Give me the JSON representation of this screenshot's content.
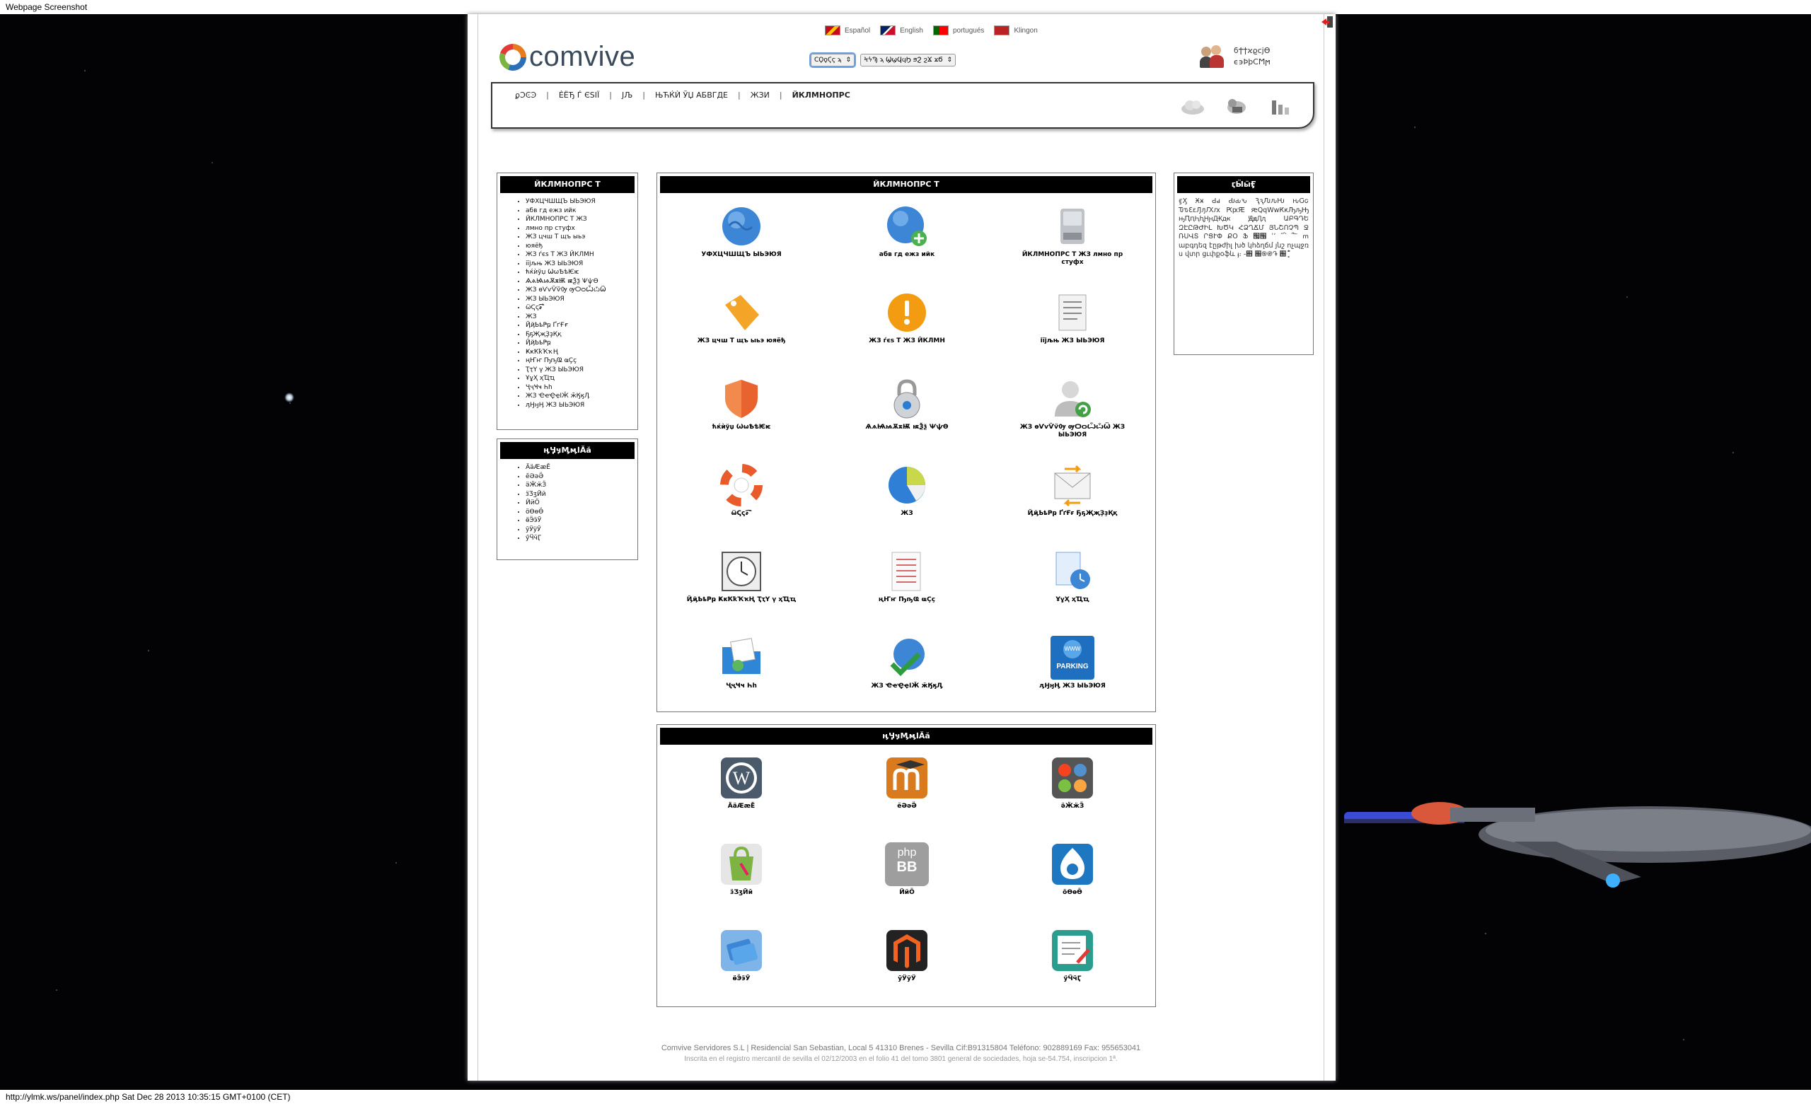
{
  "capture": {
    "top_label": "Webpage Screenshot",
    "bottom_label": "http://ylmk.ws/panel/index.php Sat Dec 28 2013 10:35:15 GMT+0100 (CET)"
  },
  "header": {
    "logo_text": "comvive",
    "languages": [
      {
        "label": "Español"
      },
      {
        "label": "English"
      },
      {
        "label": "portugués"
      },
      {
        "label": "Klingon"
      }
    ],
    "select_domain": "ϹϘϙϚϛ ϡ",
    "select_section": "ϞϟϠ ϡ ϢϣϤϥϦ ϧϨ ϩϪ ϫϬ",
    "user_name_line1": "ϭϮϯϰϱϲϳϴ",
    "user_name_line2": "ϵ϶ϷϸϹϺϻ"
  },
  "nav": {
    "items": [
      "ϼϽϾϿ",
      "ЀЁЂ Ѓ ЄЅІЇ",
      "ЈЉ",
      "ЊЋЌЍ ЎЏ АБВГДЕ",
      "ЖЗИ",
      "ЙКЛМНОПРС"
    ],
    "separator": "|"
  },
  "left_box_1": {
    "title": "ЙКЛМНОПРС Т",
    "items": [
      "УФХЦЧШЩЪ ЫЬЭЮЯ",
      "абв гд ежз ийк",
      "ЙКЛМНОПРС Т ЖЗ",
      "лмно пр стуфх",
      "ЖЗ цчш Т щъ ыьэ",
      "юяёђ",
      "ЖЗ ѓєѕ Т ЖЗ ЙКЛМН",
      "іїјљњ ЖЗ ЫЬЭЮЯ",
      "ћќѝўџ ѠѡѢѣѤѥ",
      "ѦѧѨѩѪѫѬ ѭѮѯ ѰѱѲ",
      "ЖЗ ѳѴѵѶѷѸ ѹѺѻѼѽѾ",
      "ЖЗ ЫЬЭЮЯ",
      "ѿҀҁ҂҃ ҄҅҆҇",
      "ЖЗ",
      "ҊҋҌҍҎҏ ҐґҒғ",
      "ҔҕҖҗҘҙҚқ",
      "ҊҋҌҍҎҏ",
      "ҜҝҞҟҠҡҢ",
      "ңҤҥ ҦҧҨ ҩҪҫ",
      "ҬҭҮ ү ЖЗ ЫЬЭЮЯ",
      "ҰұҲ ҳҴҵ",
      "ҶҷҸҹ Һһ",
      "ЖЗ ҼҽҾҿӀӁ ӂӃӄӅ",
      "ӆӇӈӉ ЖЗ ЫЬЭЮЯ"
    ]
  },
  "left_box_2": {
    "title": "ӊӋӌӍӎӏӐӑ",
    "items": [
      "ӒӓӔӕӖ",
      "ӗӘәӚ",
      "ӛӜӝӞ",
      "ӟӠӡӢӣ",
      "ӤӥӦ",
      "ӧӨөӪ",
      "ӫӬӭӮ",
      "ӯӰӱӲ",
      "ӳӴӵӶ"
    ]
  },
  "right_box": {
    "title": "ӷӸӹӺ",
    "text": "ӻӼ Ӿӿ Ԁԁ Ԃԃԅ ԆԇԈԉԊ ԋԌԍ ԎԏԐԑԒԓԔԕ ԖԗԘ ԙԚԛԜԝԞԟԠԡԢ ԣԤԥԦԧԨԩԪԫ ԬԭԮԯ ԱԲԳԴԵ ԶԷԸԹԺԻԼ ԽԾԿ ՀՁՂՃՄ ՅՆՇՈՉՊ Ջ ՌՍՎՏ ՐՑՒՓ ՔՕ Ֆ ՗՘ ՙ՚ ՛՜՝ ՞՟ ՠ աբգդեզ էըթժիլ խծ կհձղճմ յնշ ոչպջռ ս վտր ցւփքօֆև ֈ։ ֊֋ ֌֍֎֏ ֐ ֑֖֚֒֓֔֕֗֘֙"
  },
  "main_panel": {
    "title": "ЙКЛМНОПРС Т",
    "tiles": [
      {
        "label": "УФХЦЧШЩЪ ЫЬЭЮЯ",
        "icon": "globe-icon"
      },
      {
        "label": "абв гд ежз ийк",
        "icon": "globe-add-icon"
      },
      {
        "label": "ЙКЛМНОПРС Т ЖЗ лмно пр стуфх",
        "icon": "drive-icon"
      },
      {
        "label": "ЖЗ цчш Т щъ ыьэ юяёђ",
        "icon": "tag-icon"
      },
      {
        "label": "ЖЗ ѓєѕ Т ЖЗ ЙКЛМН",
        "icon": "warning-icon"
      },
      {
        "label": "іїјљњ ЖЗ ЫЬЭЮЯ",
        "icon": "document-icon"
      },
      {
        "label": "ћќѝўџ ѠѡѢѣѤѥ",
        "icon": "shield-icon"
      },
      {
        "label": "ѦѧѨѩѪѫѬ ѭѮѯ ѰѱѲ",
        "icon": "lock-icon"
      },
      {
        "label": "ЖЗ ѳѴѵѶѷѸ ѹѺѻѼѽѾ ЖЗ ЫЬЭЮЯ",
        "icon": "user-refresh-icon"
      },
      {
        "label": "ѿҀҁ҂҃ ҄҅҆҇",
        "icon": "lifebuoy-icon"
      },
      {
        "label": "ЖЗ",
        "icon": "pie-chart-icon"
      },
      {
        "label": "ҊҋҌҍҎҏ ҐґҒғ ҔҕҖҗҘҙҚқ",
        "icon": "mail-forward-icon"
      },
      {
        "label": "ҊҋҌҍҎҏ ҜҝҞҟҠҡҢ ҬҭҮ ү ҳҴҵ",
        "icon": "clock-icon"
      },
      {
        "label": "ңҤҥ ҦҧҨ ҩҪҫ",
        "icon": "list-icon"
      },
      {
        "label": "ҰұҲ ҳҴҵ",
        "icon": "scheduled-doc-icon"
      },
      {
        "label": "ҶҷҸҹ Һһ",
        "icon": "folder-icon"
      },
      {
        "label": "ЖЗ ҼҽҾҿӀӁ ӂӃӄӅ",
        "icon": "globe-check-icon"
      },
      {
        "label": "ӆӇӈӉ ЖЗ ЫЬЭЮЯ",
        "icon": "parking-icon"
      }
    ],
    "parking_text": "WWW",
    "parking_sub": "PARKING"
  },
  "apps_panel": {
    "title": "ӊӋӌӍӎӏӐӑ",
    "tiles": [
      {
        "label": "ӒӓӔӕӖ",
        "icon": "wordpress-icon"
      },
      {
        "label": "ӗӘәӚ",
        "icon": "moodle-icon"
      },
      {
        "label": "ӛӜӝӞ",
        "icon": "joomla-icon"
      },
      {
        "label": "ӟӠӡӢӣ",
        "icon": "prestashop-icon"
      },
      {
        "label": "ӤӥӦ",
        "icon": "phpbb-icon"
      },
      {
        "label": "ӧӨөӪ",
        "icon": "drupal-icon"
      },
      {
        "label": "ӫӬӭӮ",
        "icon": "tickets-icon"
      },
      {
        "label": "ӯӰӱӲ",
        "icon": "magento-icon"
      },
      {
        "label": "ӳӴӵӶ",
        "icon": "notes-icon"
      }
    ],
    "phpbb_text": "php",
    "phpbb_sub": "BB"
  },
  "footer": {
    "line1": "Comvive Servidores S.L | Residencial San Sebastian, Local 5 41310 Brenes - Sevilla Cif:B91315804 Teléfono: 902889169 Fax: 955653041",
    "line2": "Inscrita en el registro mercantil de sevilla el 02/12/2003 en el folio 41 del tomo 3801 general de sociedades, hoja se-54.754, inscripcion 1ª."
  }
}
